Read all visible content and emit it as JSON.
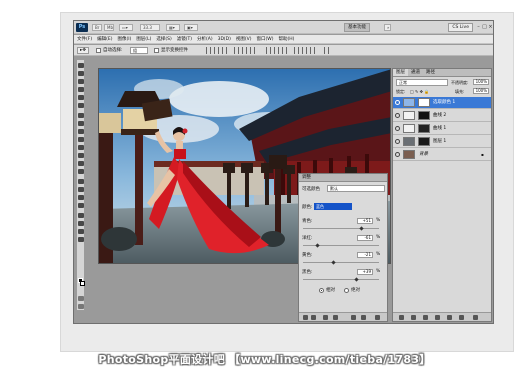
{
  "app": {
    "logo": "Ps",
    "zoom": "33.3",
    "workspace": "基本功能",
    "cs_live": "CS Live"
  },
  "menu": [
    "文件(F)",
    "编辑(E)",
    "图像(I)",
    "图层(L)",
    "选择(S)",
    "滤镜(T)",
    "分析(A)",
    "3D(D)",
    "视图(V)",
    "窗口(W)",
    "帮助(H)"
  ],
  "options": {
    "auto_select_label": "自动选择:",
    "auto_select_value": "组",
    "show_transform_label": "显示变换控件"
  },
  "adjustments": {
    "title": "调整",
    "preset_label": "可选颜色",
    "preset_value": "默认",
    "colors_label": "颜色:",
    "colors_value": "蓝色",
    "sliders": [
      {
        "label": "青色:",
        "value": "+51",
        "unit": "%"
      },
      {
        "label": "洋红:",
        "value": "-61",
        "unit": "%"
      },
      {
        "label": "黄色:",
        "value": "-21",
        "unit": "%"
      },
      {
        "label": "黑色:",
        "value": "+39",
        "unit": "%"
      }
    ],
    "method": {
      "relative": "相对",
      "absolute": "绝对",
      "selected": "relative"
    }
  },
  "layers_panel": {
    "tabs": [
      "图层",
      "通道",
      "路径"
    ],
    "blend_mode": "正常",
    "opacity_label": "不透明度:",
    "opacity_value": "100%",
    "lock_label": "锁定:",
    "fill_label": "填充:",
    "fill_value": "100%",
    "layers": [
      {
        "name": "选取颜色 1",
        "selected": true
      },
      {
        "name": "曲线 2",
        "selected": false
      },
      {
        "name": "曲线 1",
        "selected": false
      },
      {
        "name": "图层 1",
        "selected": false
      },
      {
        "name": "背景",
        "selected": false
      }
    ]
  },
  "watermark": "PhotoShop平面设计吧 【www.linecg.com/tieba/1783】"
}
